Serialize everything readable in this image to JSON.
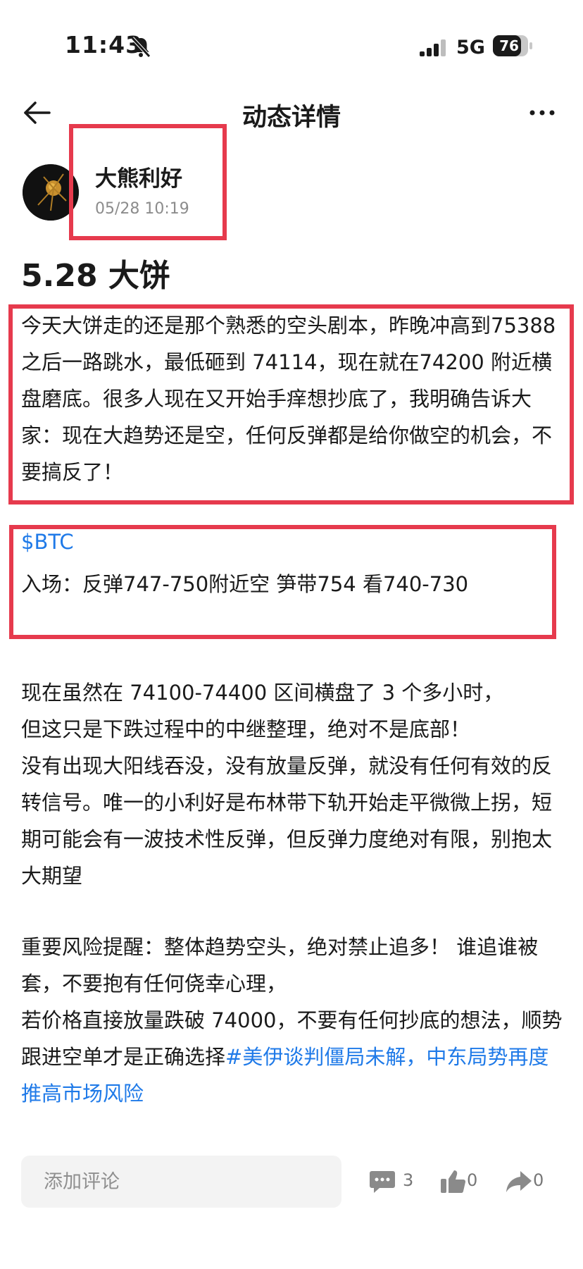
{
  "status_bar": {
    "time": "11:43",
    "network": "5G",
    "battery": "76"
  },
  "nav": {
    "title": "动态详情"
  },
  "author": {
    "name": "大熊利好",
    "timestamp": "05/28 10:19"
  },
  "post": {
    "title": "5.28 大饼",
    "paragraph1": "今天大饼走的还是那个熟悉的空头剧本，昨晚冲高到75388 之后一路跳水，最低砸到 74114，现在就在74200 附近横盘磨底。很多人现在又开始手痒想抄底了，我明确告诉大家：现在大趋势还是空，任何反弹都是给你做空的机会，不要搞反了！",
    "ticker": "$BTC",
    "entry": "入场：反弹747-750附近空  笋带754  看740-730",
    "paragraph2_lines": [
      "现在虽然在 74100-74400 区间横盘了 3 个多小时，",
      "但这只是下跌过程中的中继整理，绝对不是底部！",
      "没有出现大阳线吞没，没有放量反弹，就没有任何有效的反转信号。唯一的小利好是布林带下轨开始走平微微上拐，短期可能会有一波技术性反弹，但反弹力度绝对有限，别抱太大期望"
    ],
    "paragraph3_lines": [
      "重要风险提醒：整体趋势空头，绝对禁止追多！ 谁追谁被套，不要抱有任何侥幸心理，",
      "若价格直接放量跌破 74000，不要有任何抄底的想法，顺势跟进空单才是正确选择"
    ],
    "topic": "#美伊谈判僵局未解，中东局势再度推高市场风险"
  },
  "bottom_bar": {
    "comment_placeholder": "添加评论",
    "comments_count": "3",
    "likes_count": "0",
    "shares_count": "0"
  },
  "colors": {
    "highlight_box": "#e63a4d",
    "link": "#1f7ae8"
  },
  "icons": [
    "bell-muted-icon",
    "signal-icon",
    "battery-icon",
    "back-arrow-icon",
    "more-icon",
    "comment-icon",
    "like-icon",
    "share-icon"
  ]
}
